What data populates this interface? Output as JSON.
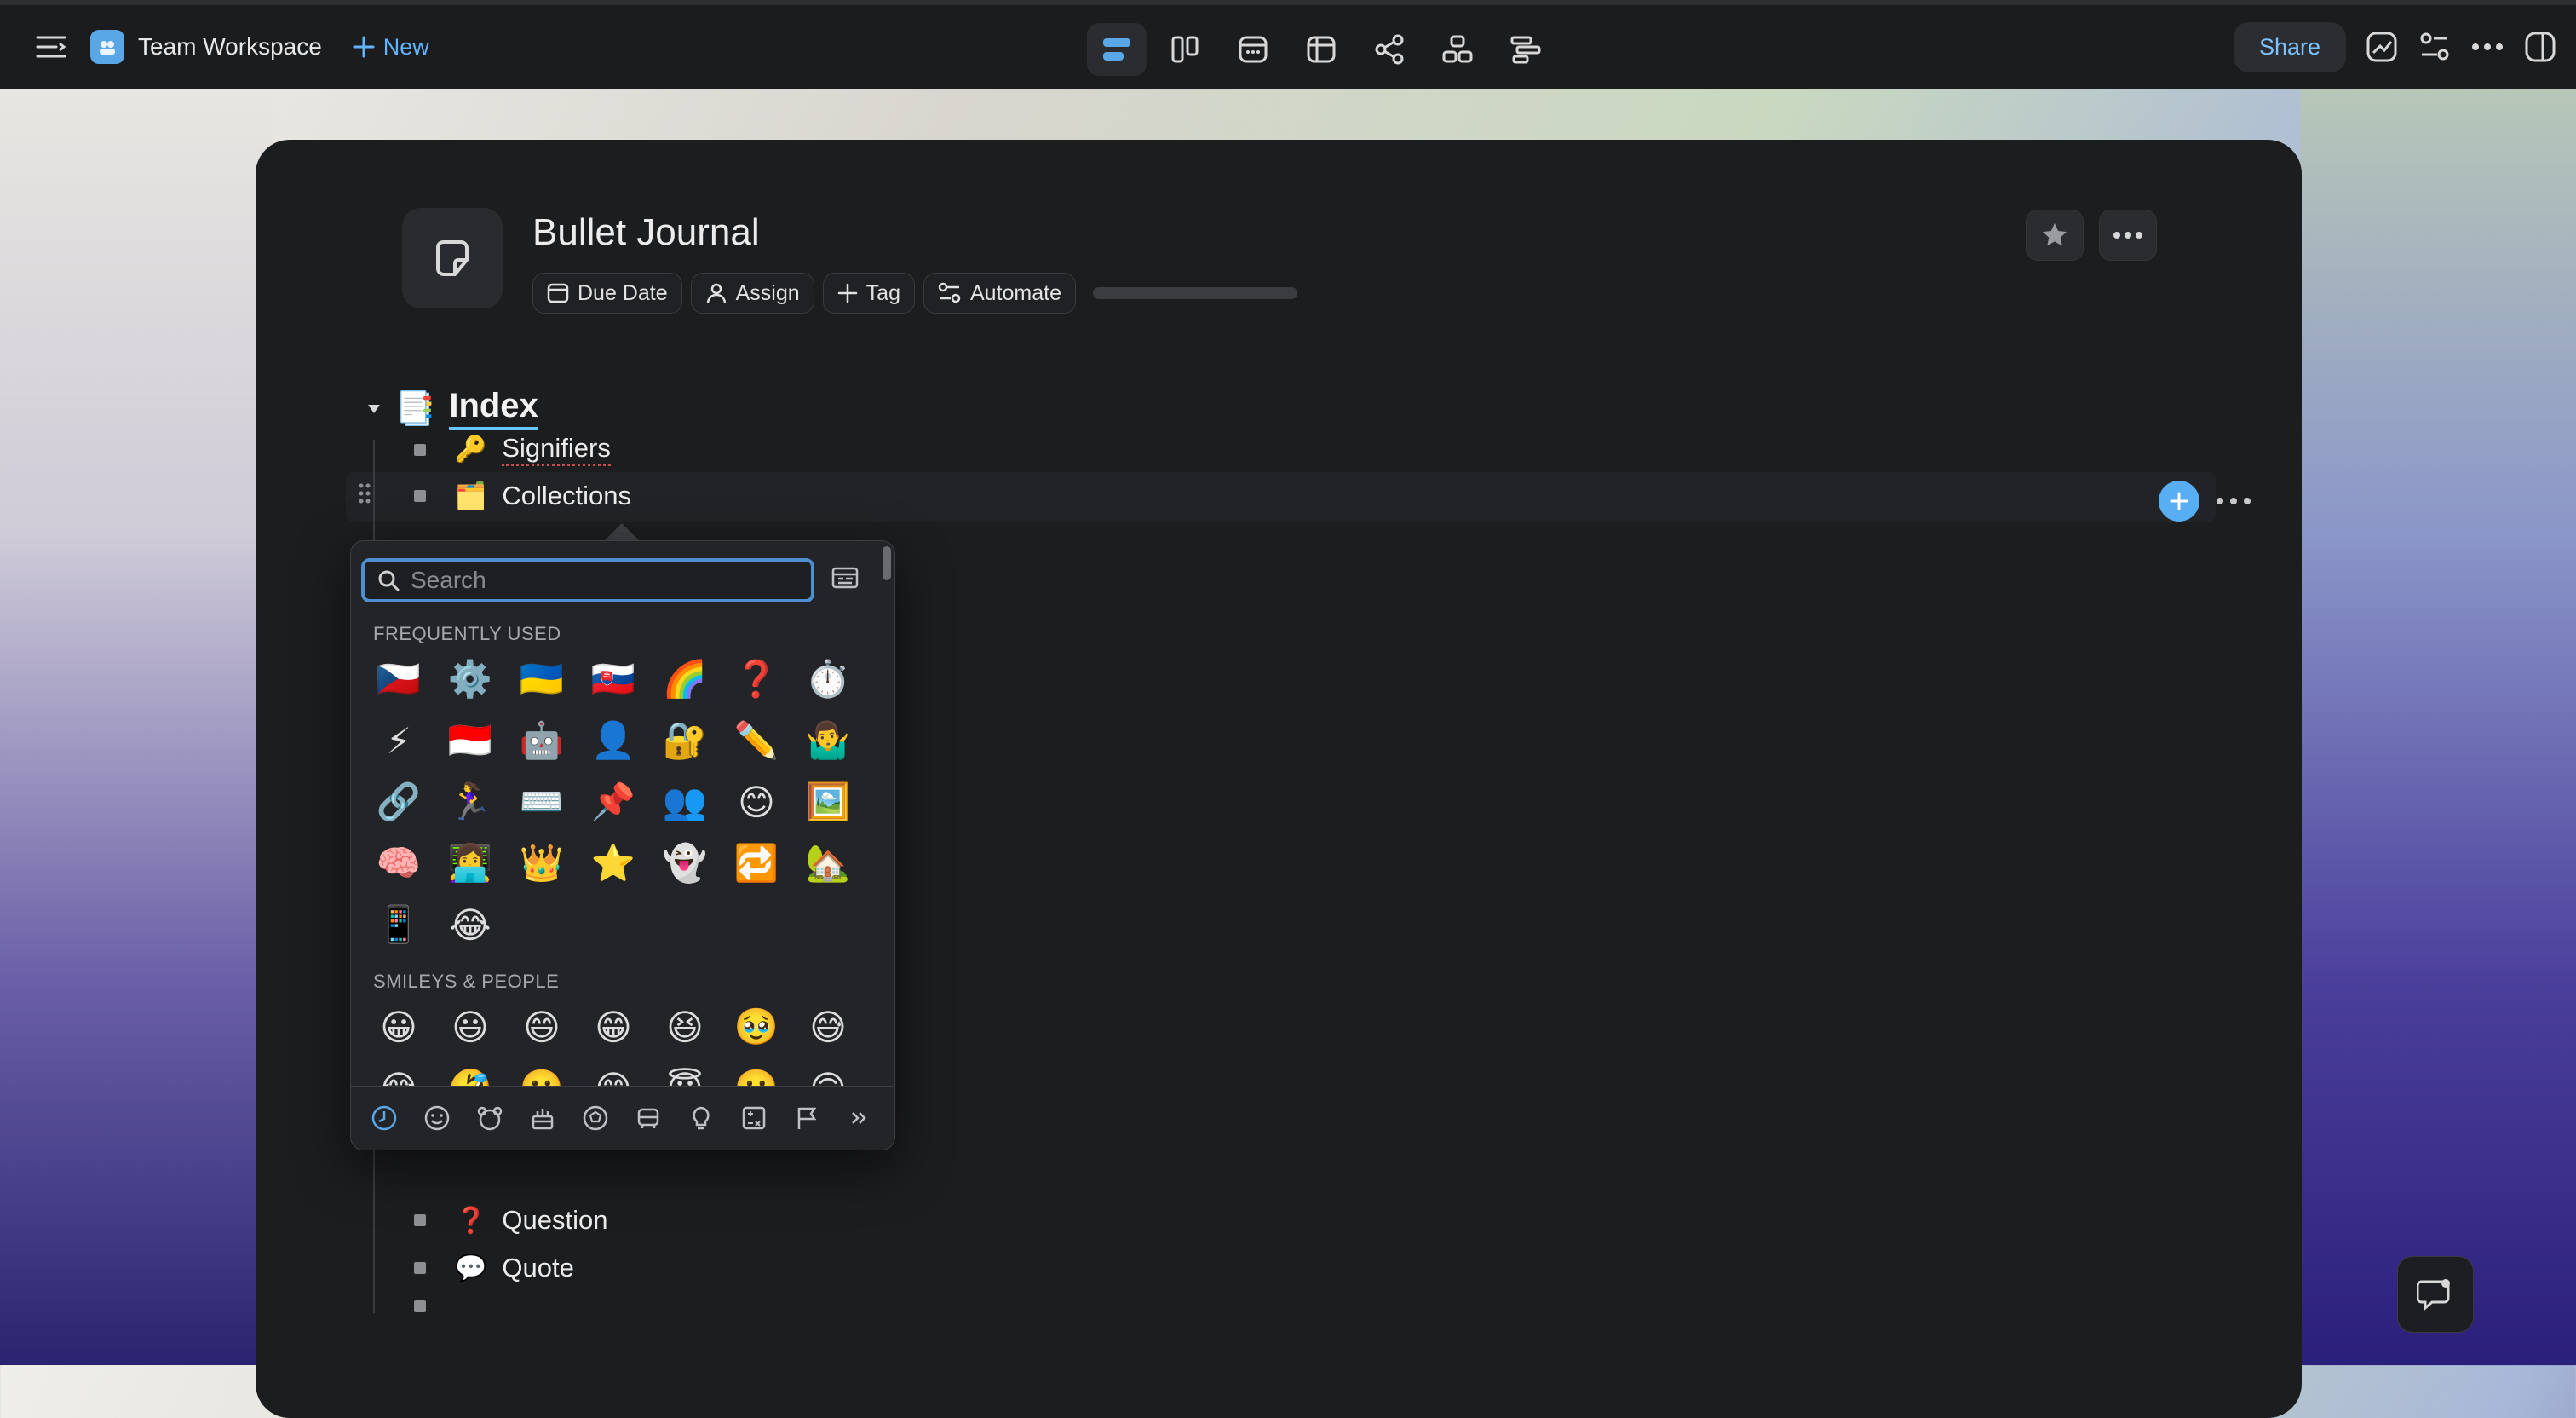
{
  "topbar": {
    "workspace_name": "Team Workspace",
    "new_label": "New",
    "share_label": "Share",
    "views": [
      "list-view-icon",
      "board-view-icon",
      "calendar-view-icon",
      "table-view-icon",
      "mindmap-view-icon",
      "org-view-icon",
      "gantt-view-icon"
    ]
  },
  "page": {
    "title": "Bullet Journal",
    "chips": {
      "due_date": "Due Date",
      "assign": "Assign",
      "tag": "Tag",
      "automate": "Automate"
    }
  },
  "outline": {
    "index_emoji": "📑",
    "index_title": "Index",
    "items": [
      {
        "emoji": "🔑",
        "label": "Signifiers"
      },
      {
        "emoji": "🗂️",
        "label": "Collections"
      }
    ],
    "lower_items": [
      {
        "emoji": "❓",
        "label": "Question"
      },
      {
        "emoji": "💬",
        "label": "Quote"
      },
      {
        "emoji": "",
        "label": ""
      }
    ]
  },
  "emoji_picker": {
    "search_placeholder": "Search",
    "frequently_used_label": "FREQUENTLY USED",
    "frequently_used": [
      "🇨🇿",
      "⚙️",
      "🇺🇦",
      "🇸🇰",
      "🌈",
      "❓",
      "⏱️",
      "⚡",
      "🇮🇩",
      "🤖",
      "👤",
      "🔐",
      "✏️",
      "🤷‍♂️",
      "🔗",
      "🏃‍♀️",
      "⌨️",
      "📌",
      "👥",
      "😊",
      "🖼️",
      "🧠",
      "👩‍💻",
      "👑",
      "⭐",
      "👻",
      "🔁",
      "🏡",
      "📱",
      "😂"
    ],
    "smileys_label": "SMILEYS & PEOPLE",
    "smileys": [
      "😀",
      "😃",
      "😄",
      "😁",
      "😆",
      "🥹",
      "😅",
      "😂",
      "🤣",
      "🥲",
      "😊",
      "😇",
      "🙂",
      "🙃"
    ],
    "categories": [
      "clock-icon",
      "smiley-icon",
      "bear-icon",
      "food-icon",
      "ball-icon",
      "car-icon",
      "bulb-icon",
      "symbols-icon",
      "flag-icon",
      "chevrons-right-icon"
    ]
  },
  "colors": {
    "accent": "#58aef2",
    "topbar_bg": "#1b1c1e",
    "card_bg": "#1c1d1f",
    "share_text": "#7cc3ff"
  }
}
